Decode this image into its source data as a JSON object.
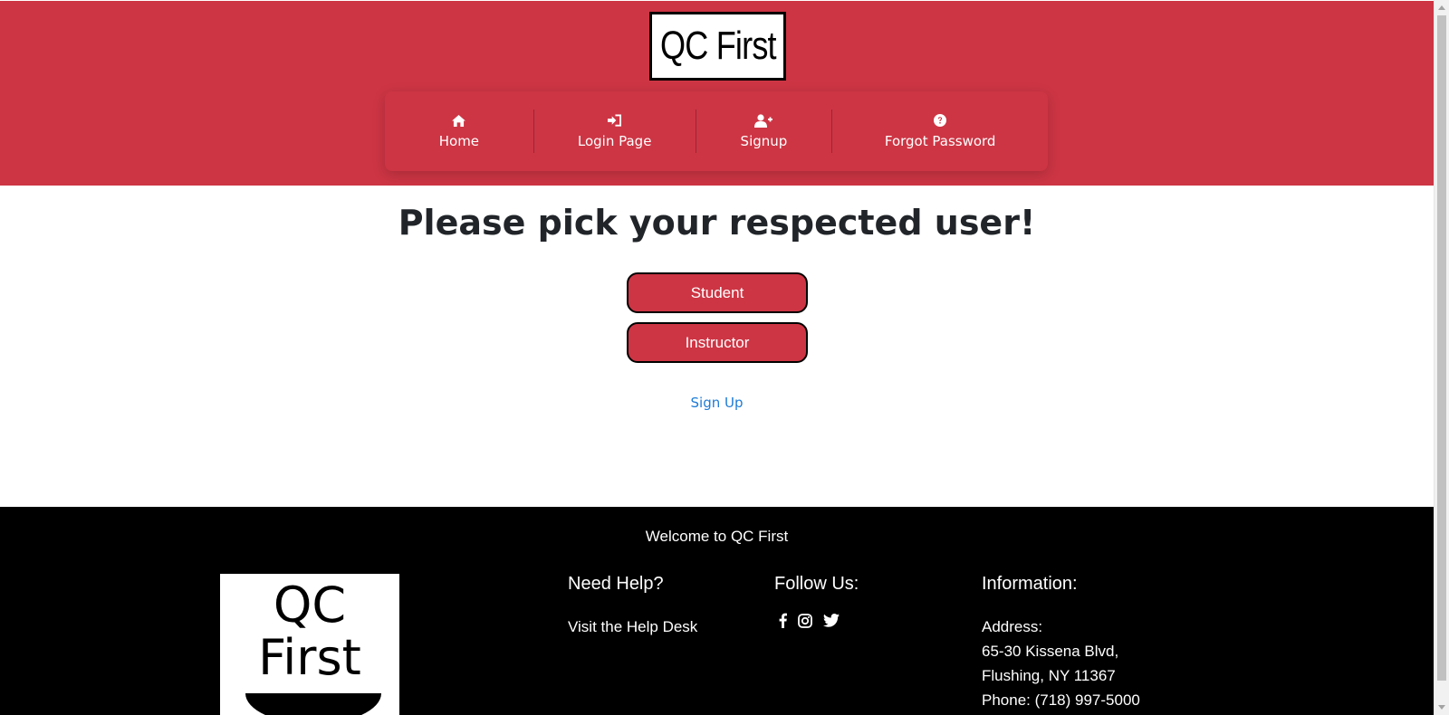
{
  "header": {
    "logo_text": "QC First",
    "nav": [
      {
        "label": "Home",
        "icon": "home-icon"
      },
      {
        "label": "Login Page",
        "icon": "sign-in-icon"
      },
      {
        "label": "Signup",
        "icon": "user-plus-icon"
      },
      {
        "label": "Forgot Password",
        "icon": "question-circle-icon"
      }
    ]
  },
  "main": {
    "title": "Please pick your respected user!",
    "student_label": "Student",
    "instructor_label": "Instructor",
    "signup_link": "Sign Up"
  },
  "footer": {
    "welcome": "Welcome to QC First",
    "logo_text": "QC First",
    "help": {
      "heading": "Need Help?",
      "link": "Visit the Help Desk"
    },
    "follow": {
      "heading": "Follow Us:",
      "icons": [
        "facebook-icon",
        "instagram-icon",
        "twitter-icon"
      ]
    },
    "info": {
      "heading": "Information:",
      "address_label": "Address:",
      "address_line1": "65-30 Kissena Blvd,",
      "address_line2": "Flushing, NY 11367",
      "phone": "Phone: (718) 997-5000"
    }
  },
  "colors": {
    "brand_red": "#cd3544",
    "footer_bg": "#000000",
    "link_blue": "#1e7bd6",
    "title_text": "#212529"
  }
}
